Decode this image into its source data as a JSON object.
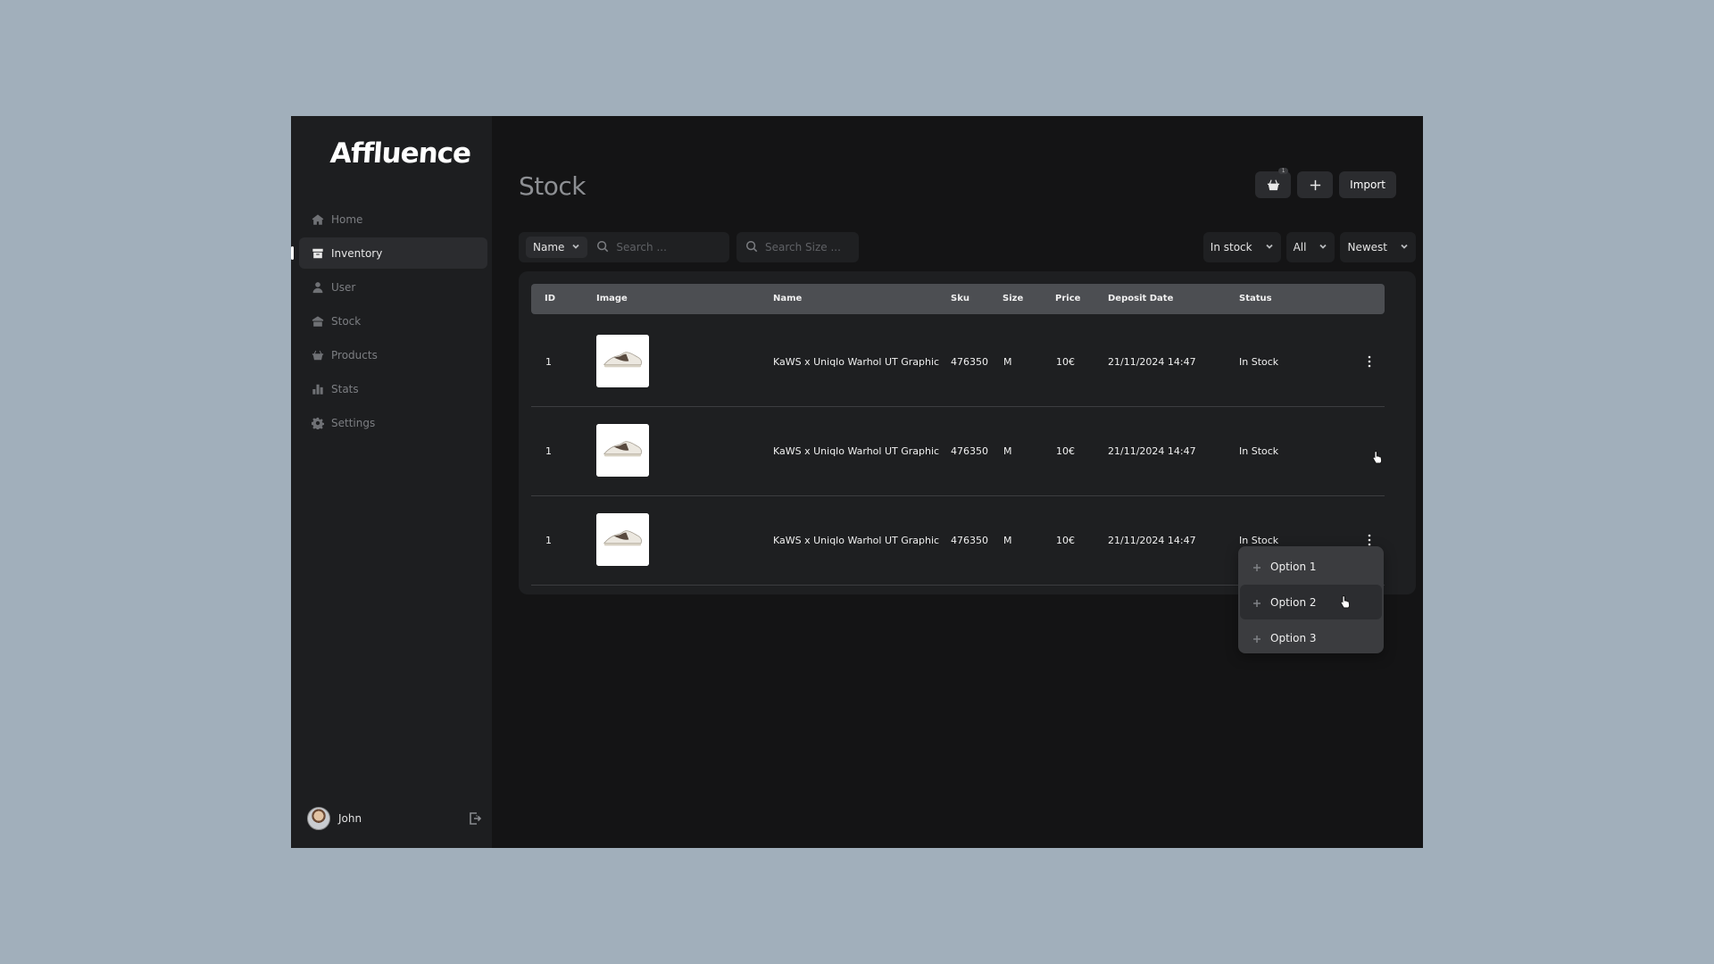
{
  "app": {
    "logo": "Affluence"
  },
  "sidebar": {
    "items": [
      {
        "label": "Home",
        "icon": "home-icon",
        "active": false
      },
      {
        "label": "Inventory",
        "icon": "inventory-icon",
        "active": true
      },
      {
        "label": "User",
        "icon": "user-icon",
        "active": false
      },
      {
        "label": "Stock",
        "icon": "stock-icon",
        "active": false
      },
      {
        "label": "Products",
        "icon": "products-icon",
        "active": false
      },
      {
        "label": "Stats",
        "icon": "stats-icon",
        "active": false
      },
      {
        "label": "Settings",
        "icon": "settings-icon",
        "active": false
      }
    ],
    "user": {
      "name": "John"
    }
  },
  "header": {
    "title": "Stock",
    "cart_badge": "1",
    "import_label": "Import"
  },
  "filters": {
    "field_select": "Name",
    "search_placeholder": "Search ...",
    "size_placeholder": "Search Size ...",
    "stock_filter": "In stock",
    "category_filter": "All",
    "sort": "Newest"
  },
  "table": {
    "columns": [
      "ID",
      "Image",
      "Name",
      "Sku",
      "Size",
      "Price",
      "Deposit Date",
      "Status"
    ],
    "rows": [
      {
        "id": "1",
        "name": "KaWS x Uniqlo Warhol UT Graphic",
        "sku": "476350",
        "size": "M",
        "price": "10€",
        "date": "21/11/2024 14:47",
        "status": "In Stock"
      },
      {
        "id": "1",
        "name": "KaWS x Uniqlo Warhol UT Graphic",
        "sku": "476350",
        "size": "M",
        "price": "10€",
        "date": "21/11/2024 14:47",
        "status": "In Stock"
      },
      {
        "id": "1",
        "name": "KaWS x Uniqlo Warhol UT Graphic",
        "sku": "476350",
        "size": "M",
        "price": "10€",
        "date": "21/11/2024 14:47",
        "status": "In Stock"
      }
    ]
  },
  "row_menu": {
    "options": [
      "Option 1",
      "Option 2",
      "Option 3"
    ]
  },
  "colors": {
    "backdrop": "#a1afbb",
    "app_bg": "#141415",
    "sidebar_bg": "#1d1e20",
    "table_header": "#4c4e52"
  }
}
